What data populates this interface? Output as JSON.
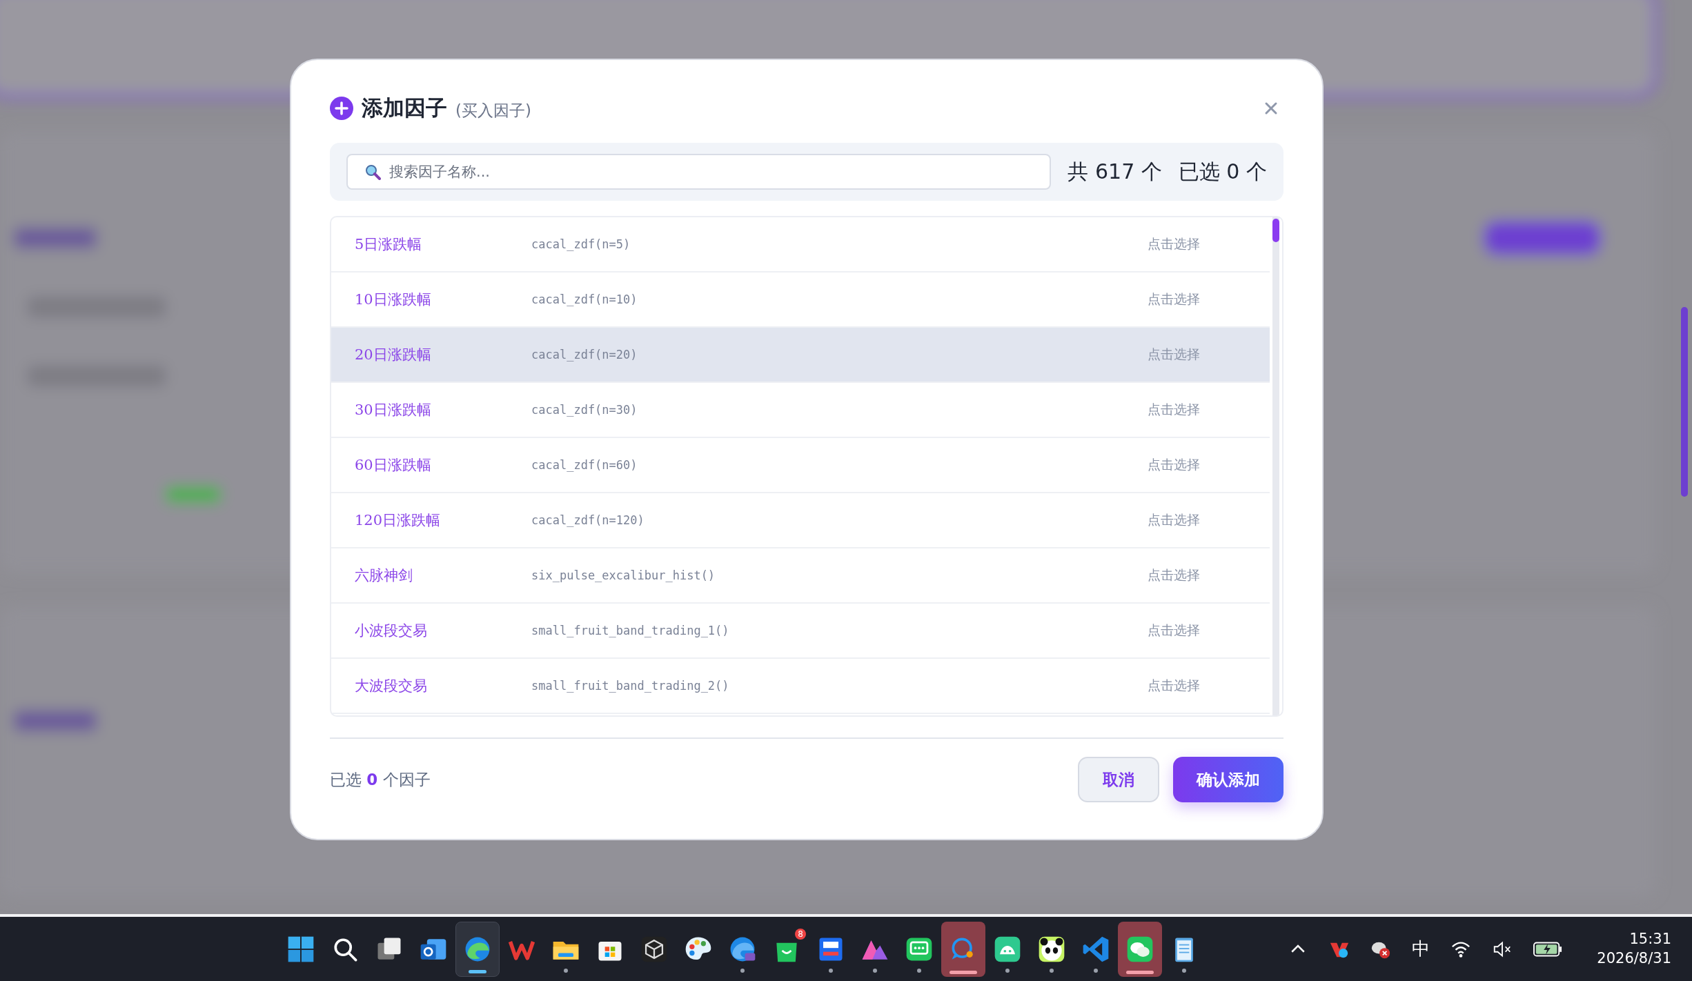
{
  "dialog": {
    "title": "添加因子",
    "subtitle": "(买入因子)",
    "search": {
      "placeholder": "搜索因子名称..."
    },
    "total": "共 617 个",
    "selected_count": "已选 0 个",
    "rows": [
      {
        "name": "5日涨跌幅",
        "code": "cacal_zdf(n=5)",
        "action": "点击选择",
        "highlighted": false
      },
      {
        "name": "10日涨跌幅",
        "code": "cacal_zdf(n=10)",
        "action": "点击选择",
        "highlighted": false
      },
      {
        "name": "20日涨跌幅",
        "code": "cacal_zdf(n=20)",
        "action": "点击选择",
        "highlighted": true
      },
      {
        "name": "30日涨跌幅",
        "code": "cacal_zdf(n=30)",
        "action": "点击选择",
        "highlighted": false
      },
      {
        "name": "60日涨跌幅",
        "code": "cacal_zdf(n=60)",
        "action": "点击选择",
        "highlighted": false
      },
      {
        "name": "120日涨跌幅",
        "code": "cacal_zdf(n=120)",
        "action": "点击选择",
        "highlighted": false
      },
      {
        "name": "六脉神剑",
        "code": "six_pulse_excalibur_hist()",
        "action": "点击选择",
        "highlighted": false
      },
      {
        "name": "小波段交易",
        "code": "small_fruit_band_trading_1()",
        "action": "点击选择",
        "highlighted": false
      },
      {
        "name": "大波段交易",
        "code": "small_fruit_band_trading_2()",
        "action": "点击选择",
        "highlighted": false
      }
    ],
    "footer": {
      "before": "已选",
      "count": "0",
      "after": "个因子"
    },
    "buttons": [
      {
        "label": "取消",
        "kind": "secondary"
      },
      {
        "label": "确认添加",
        "kind": "primary"
      }
    ]
  },
  "taskbar": {
    "apps": [
      {
        "running": false,
        "active": false,
        "attention": false
      },
      {
        "running": false,
        "active": false,
        "attention": false
      },
      {
        "running": false,
        "active": false,
        "attention": false
      },
      {
        "running": false,
        "active": false,
        "attention": false
      },
      {
        "running": true,
        "active": true,
        "attention": false
      },
      {
        "running": false,
        "active": false,
        "attention": false
      },
      {
        "running": true,
        "active": false,
        "attention": false
      },
      {
        "running": false,
        "active": false,
        "attention": false
      },
      {
        "running": false,
        "active": false,
        "attention": false
      },
      {
        "running": false,
        "active": false,
        "attention": false
      },
      {
        "running": true,
        "active": false,
        "attention": false
      },
      {
        "running": false,
        "active": false,
        "attention": false,
        "badge": "8"
      },
      {
        "running": true,
        "active": false,
        "attention": false
      },
      {
        "running": true,
        "active": false,
        "attention": false
      },
      {
        "running": true,
        "active": false,
        "attention": false
      },
      {
        "running": true,
        "active": false,
        "attention": true
      },
      {
        "running": true,
        "active": false,
        "attention": false
      },
      {
        "running": true,
        "active": false,
        "attention": false
      },
      {
        "running": true,
        "active": false,
        "attention": false
      },
      {
        "running": true,
        "active": false,
        "attention": true
      },
      {
        "running": true,
        "active": false,
        "attention": false
      }
    ],
    "tray": {
      "ime": "中",
      "time": "15:31",
      "date": "2026/8/31"
    }
  }
}
